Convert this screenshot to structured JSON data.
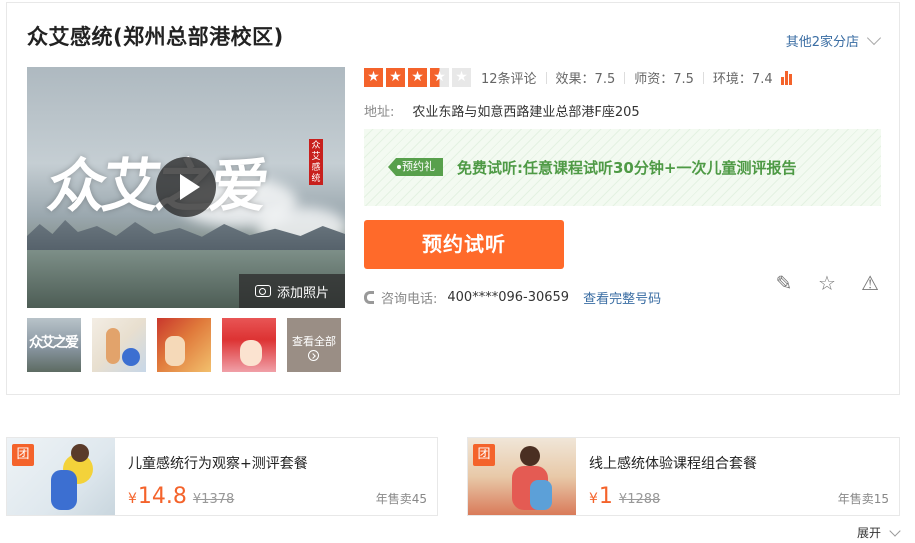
{
  "shop": {
    "title": "众艾感统(郑州总部港校区)",
    "branches_link": "其他2家分店"
  },
  "media": {
    "hero_calligraphy": "众艾之爱",
    "hero_seal": "众艾感统",
    "add_photo_label": "添加照片",
    "view_all_label": "查看全部",
    "thumb1_text": "众艾之爱"
  },
  "rating": {
    "stars": 3.5,
    "review_count": "12条评论",
    "effect": "效果：7.5",
    "teacher": "师资：7.5",
    "environment": "环境：7.4"
  },
  "address": {
    "label": "地址:",
    "value": "农业东路与如意西路建业总部港F座205"
  },
  "promo": {
    "tag": "预约礼",
    "text": "免费试听:任意课程试听30分钟+一次儿童测评报告"
  },
  "booking": {
    "button_label": "预约试听"
  },
  "contact": {
    "label": "咨询电话:",
    "phone": "400****096-30659",
    "full_number_link": "查看完整号码"
  },
  "deals": [
    {
      "badge": "团",
      "name": "儿童感统行为观察+测评套餐",
      "currency": "¥",
      "price": "14.8",
      "original_price": "¥1378",
      "sold": "年售卖45"
    },
    {
      "badge": "团",
      "name": "线上感统体验课程组合套餐",
      "currency": "¥",
      "price": "1",
      "original_price": "¥1288",
      "sold": "年售卖15"
    }
  ],
  "expand_label": "展开",
  "colors": {
    "accent": "#f4632b",
    "link": "#3a6da3",
    "promo_green": "#4e9a45"
  }
}
